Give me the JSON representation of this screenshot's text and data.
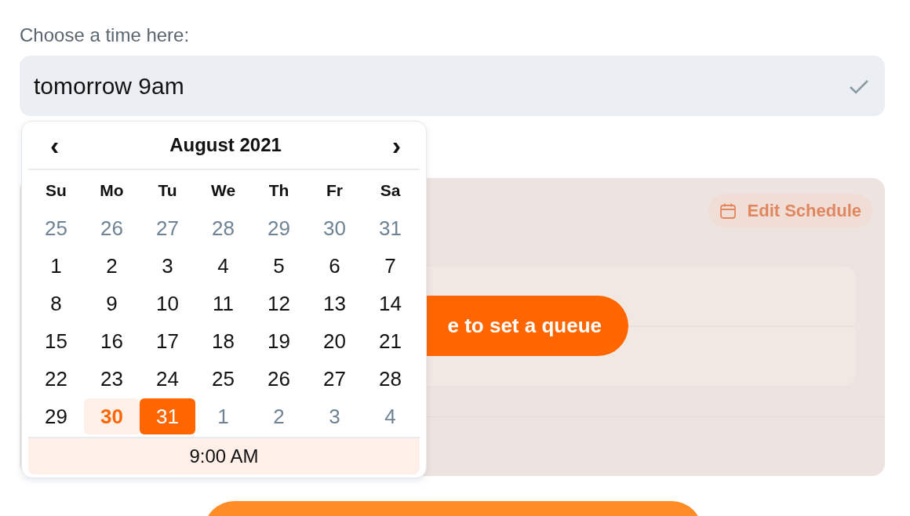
{
  "label": "Choose a time here:",
  "input": {
    "value": "tomorrow 9am",
    "valid": true
  },
  "calendar": {
    "prev": "‹",
    "title": "August 2021",
    "next": "›",
    "weekdays": [
      "Su",
      "Mo",
      "Tu",
      "We",
      "Th",
      "Fr",
      "Sa"
    ],
    "days": [
      {
        "label": "25",
        "kind": "outside",
        "today": false,
        "selected": false
      },
      {
        "label": "26",
        "kind": "outside",
        "today": false,
        "selected": false
      },
      {
        "label": "27",
        "kind": "outside",
        "today": false,
        "selected": false
      },
      {
        "label": "28",
        "kind": "outside",
        "today": false,
        "selected": false
      },
      {
        "label": "29",
        "kind": "outside",
        "today": false,
        "selected": false
      },
      {
        "label": "30",
        "kind": "outside",
        "today": false,
        "selected": false
      },
      {
        "label": "31",
        "kind": "outside",
        "today": false,
        "selected": false
      },
      {
        "label": "1",
        "kind": "month",
        "today": false,
        "selected": false
      },
      {
        "label": "2",
        "kind": "month",
        "today": false,
        "selected": false
      },
      {
        "label": "3",
        "kind": "month",
        "today": false,
        "selected": false
      },
      {
        "label": "4",
        "kind": "month",
        "today": false,
        "selected": false
      },
      {
        "label": "5",
        "kind": "month",
        "today": false,
        "selected": false
      },
      {
        "label": "6",
        "kind": "month",
        "today": false,
        "selected": false
      },
      {
        "label": "7",
        "kind": "month",
        "today": false,
        "selected": false
      },
      {
        "label": "8",
        "kind": "month",
        "today": false,
        "selected": false
      },
      {
        "label": "9",
        "kind": "month",
        "today": false,
        "selected": false
      },
      {
        "label": "10",
        "kind": "month",
        "today": false,
        "selected": false
      },
      {
        "label": "11",
        "kind": "month",
        "today": false,
        "selected": false
      },
      {
        "label": "12",
        "kind": "month",
        "today": false,
        "selected": false
      },
      {
        "label": "13",
        "kind": "month",
        "today": false,
        "selected": false
      },
      {
        "label": "14",
        "kind": "month",
        "today": false,
        "selected": false
      },
      {
        "label": "15",
        "kind": "month",
        "today": false,
        "selected": false
      },
      {
        "label": "16",
        "kind": "month",
        "today": false,
        "selected": false
      },
      {
        "label": "17",
        "kind": "month",
        "today": false,
        "selected": false
      },
      {
        "label": "18",
        "kind": "month",
        "today": false,
        "selected": false
      },
      {
        "label": "19",
        "kind": "month",
        "today": false,
        "selected": false
      },
      {
        "label": "20",
        "kind": "month",
        "today": false,
        "selected": false
      },
      {
        "label": "21",
        "kind": "month",
        "today": false,
        "selected": false
      },
      {
        "label": "22",
        "kind": "month",
        "today": false,
        "selected": false
      },
      {
        "label": "23",
        "kind": "month",
        "today": false,
        "selected": false
      },
      {
        "label": "24",
        "kind": "month",
        "today": false,
        "selected": false
      },
      {
        "label": "25",
        "kind": "month",
        "today": false,
        "selected": false
      },
      {
        "label": "26",
        "kind": "month",
        "today": false,
        "selected": false
      },
      {
        "label": "27",
        "kind": "month",
        "today": false,
        "selected": false
      },
      {
        "label": "28",
        "kind": "month",
        "today": false,
        "selected": false
      },
      {
        "label": "29",
        "kind": "month",
        "today": false,
        "selected": false
      },
      {
        "label": "30",
        "kind": "month",
        "today": true,
        "selected": false
      },
      {
        "label": "31",
        "kind": "month",
        "today": false,
        "selected": true
      },
      {
        "label": "1",
        "kind": "outside",
        "today": false,
        "selected": false
      },
      {
        "label": "2",
        "kind": "outside",
        "today": false,
        "selected": false
      },
      {
        "label": "3",
        "kind": "outside",
        "today": false,
        "selected": false
      },
      {
        "label": "4",
        "kind": "outside",
        "today": false,
        "selected": false
      }
    ],
    "time": "9:00 AM"
  },
  "schedule": {
    "edit_button": {
      "label": "Edit Schedule",
      "disabled": true
    },
    "queue_button": "e to set a queue"
  }
}
